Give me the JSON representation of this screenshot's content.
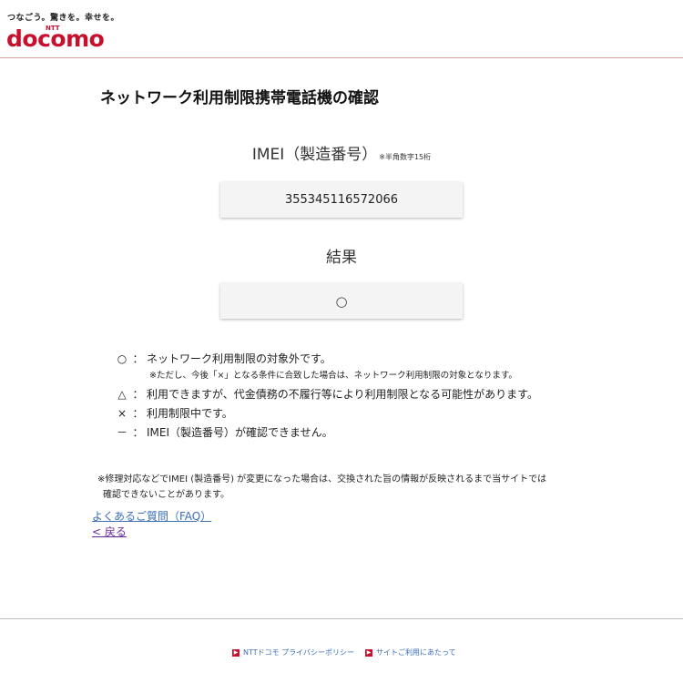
{
  "header": {
    "tagline": "つなごう。驚きを。幸せを。",
    "brand_small": "NTT",
    "brand": "docomo"
  },
  "page_title": "ネットワーク利用制限携帯電話機の確認",
  "imei": {
    "label": "IMEI（製造番号）",
    "note": "※半角数字15桁",
    "value": "355345116572066"
  },
  "result": {
    "label": "結果",
    "value": "○"
  },
  "legend": [
    {
      "symbol": "○",
      "colon": "：",
      "text": "ネットワーク利用制限の対象外です。"
    },
    {
      "sub": "※ただし、今後「×」となる条件に合致した場合は、ネットワーク利用制限の対象となります。"
    },
    {
      "symbol": "△",
      "colon": "：",
      "text": "利用できますが、代金債務の不履行等により利用制限となる可能性があります。"
    },
    {
      "symbol": "×",
      "colon": "：",
      "text": "利用制限中です。"
    },
    {
      "symbol": "－",
      "colon": "：",
      "text": "IMEI（製造番号）が確認できません。"
    }
  ],
  "footnote": {
    "line1": "※修理対応などでIMEI (製造番号) が変更になった場合は、交換された旨の情報が反映されるまで当サイトでは",
    "line2": "確認できないことがあります。"
  },
  "links": {
    "faq": "よくあるご質問（FAQ）",
    "back": "< 戻る"
  },
  "footer": {
    "privacy": "NTTドコモ プライバシーポリシー",
    "terms": "サイトご利用にあたって"
  },
  "colors": {
    "brand_red": "#c8102e",
    "link_blue": "#3b6fb6",
    "visited_purple": "#6a2a9c"
  }
}
